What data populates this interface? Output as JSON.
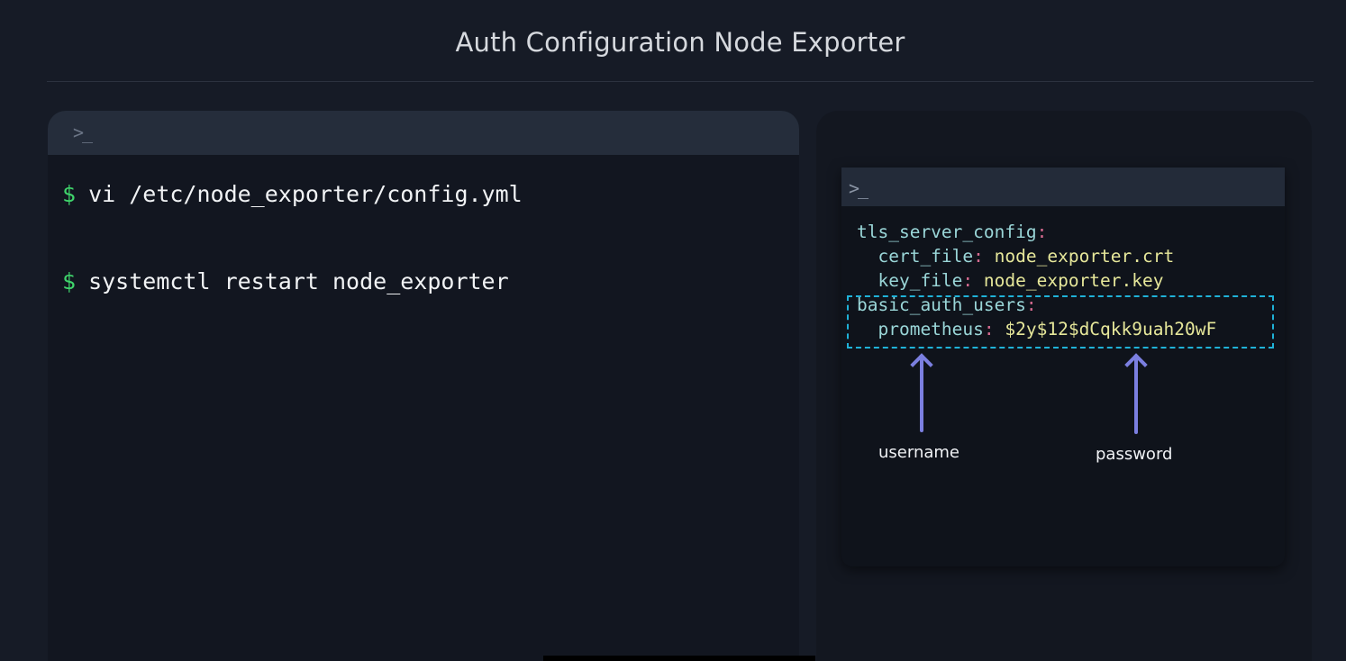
{
  "title": "Auth Configuration Node Exporter",
  "left_terminal": {
    "prompt_icon": ">_",
    "commands": [
      {
        "symbol": "$",
        "text": "vi /etc/node_exporter/config.yml"
      },
      {
        "symbol": "$",
        "text": "systemctl restart node_exporter"
      }
    ]
  },
  "right_terminal": {
    "prompt_icon": ">_",
    "config": {
      "tls_key": "tls_server_config",
      "cert_key": "cert_file",
      "cert_value": "node_exporter.crt",
      "key_key": "key_file",
      "key_value": "node_exporter.key",
      "auth_key": "basic_auth_users",
      "user_key": "prometheus",
      "user_value": "$2y$12$dCqkk9uah20wF"
    },
    "colon": ":"
  },
  "annotations": {
    "username_label": "username",
    "password_label": "password"
  },
  "colors": {
    "background": "#161b26",
    "dollar": "#3fd46b",
    "yaml_key": "#9ad6d8",
    "yaml_colon": "#d66a8f",
    "yaml_value": "#e6e79a",
    "highlight_border": "#1fb2d8",
    "arrow": "#7b7fe0"
  }
}
